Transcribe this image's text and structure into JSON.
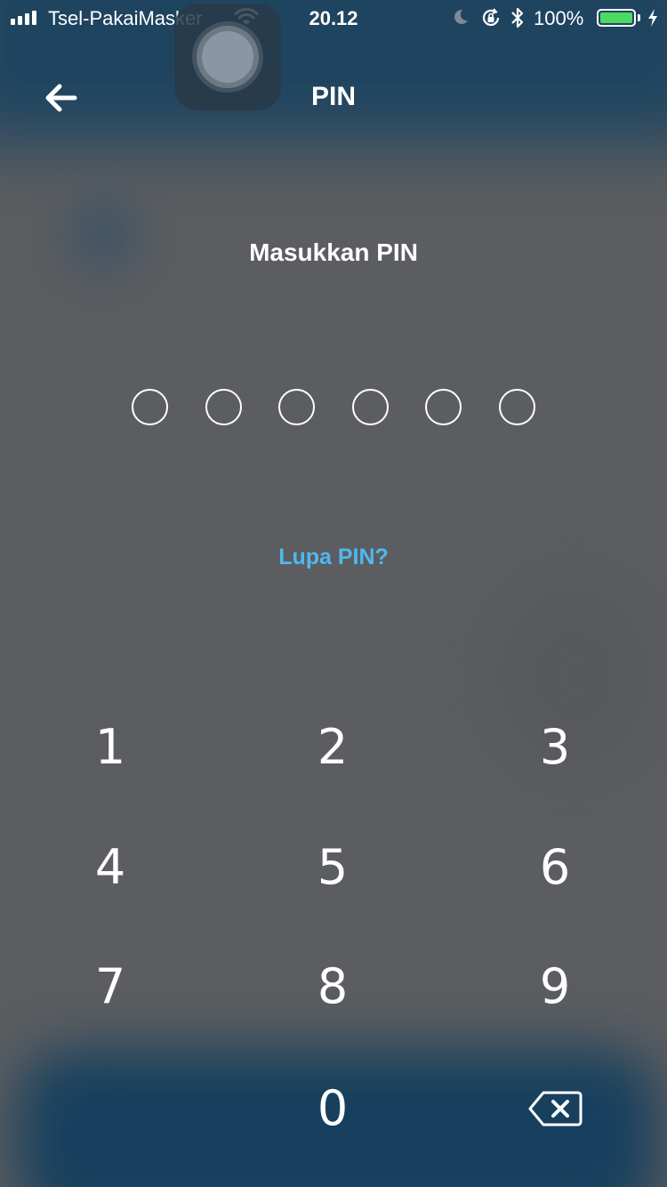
{
  "status_bar": {
    "carrier": "Tsel-PakaiMasker",
    "time": "20.12",
    "battery_percent": "100%",
    "battery_level": 1.0,
    "signal_bars": 4,
    "battery_color": "#4cd964",
    "icons": [
      "signal-icon",
      "wifi-icon",
      "moon-icon",
      "rotation-lock-icon",
      "bluetooth-icon",
      "battery-icon",
      "charging-icon"
    ]
  },
  "nav": {
    "title": "PIN",
    "back_icon": "arrow-left-icon"
  },
  "pin": {
    "prompt": "Masukkan PIN",
    "length": 6,
    "entered": 0,
    "forgot_label": "Lupa PIN?",
    "forgot_color": "#4fb8ef"
  },
  "keypad": {
    "keys": [
      "1",
      "2",
      "3",
      "4",
      "5",
      "6",
      "7",
      "8",
      "9",
      "0"
    ],
    "delete_icon": "backspace-icon"
  }
}
